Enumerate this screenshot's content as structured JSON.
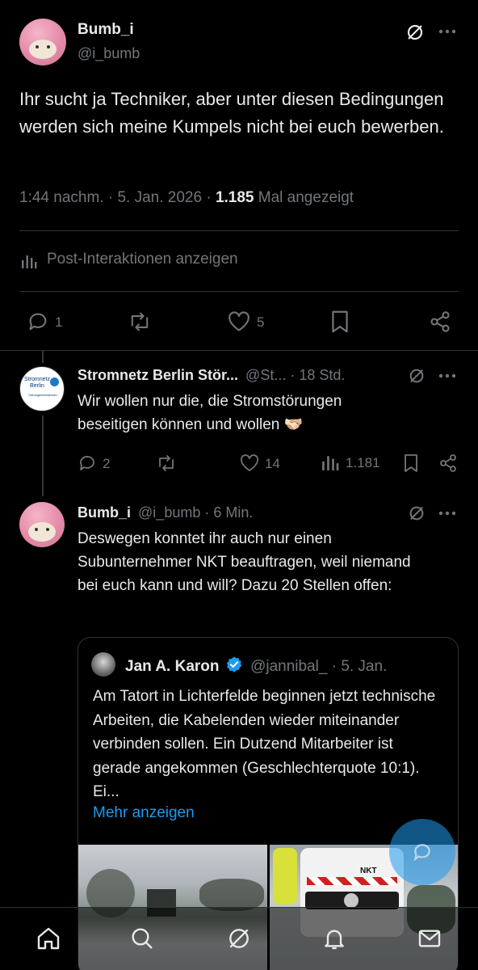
{
  "main_post": {
    "author_name": "Bumb_i",
    "author_handle": "@i_bumb",
    "text": "Ihr sucht ja Techniker, aber unter diesen Bedingungen werden sich meine Kumpels nicht bei euch bewerben.",
    "time": "1:44 nachm.",
    "date": "5. Jan. 2026",
    "views_count": "1.185",
    "views_label": "Mal angezeigt",
    "interactions_label": "Post-Interaktionen anzeigen",
    "replies": "1",
    "reposts": "",
    "likes": "5"
  },
  "reply1": {
    "author_name": "Stromnetz Berlin Stör...",
    "author_handle": "@St...",
    "time": "18 Std.",
    "text": "Wir wollen nur die, die Stromstörungen beseitigen können und wollen 🫱🏻‍🫲🏼",
    "avatar_text": "Stromnetz Berlin",
    "avatar_subtext": "Störungsinformationen",
    "replies": "2",
    "likes": "14",
    "views": "1.181"
  },
  "reply2": {
    "author_name": "Bumb_i",
    "author_handle": "@i_bumb",
    "time": "6 Min.",
    "text": "Deswegen konntet ihr auch nur einen Subunternehmer NKT beauftragen, weil niemand bei euch kann und will? Dazu 20 Stellen offen:"
  },
  "quote": {
    "author_name": "Jan A. Karon",
    "author_handle": "@jannibal_",
    "time": "5. Jan.",
    "text": "Am Tatort in Lichterfelde beginnen jetzt technische Arbeiten, die Kabelenden wieder miteinander verbinden sollen. Ein Dutzend Mitarbeiter ist gerade angekommen (Geschlechterquote 10:1). Ei...",
    "more_label": "Mehr anzeigen",
    "van_logo": "NKT"
  },
  "icons": {
    "grok": "grok-icon",
    "more": "more-icon",
    "reply": "reply-icon",
    "repost": "repost-icon",
    "like": "like-icon",
    "bookmark": "bookmark-icon",
    "share": "share-icon",
    "analytics": "analytics-icon",
    "verified": "verified-icon"
  },
  "nav": [
    "home-icon",
    "search-icon",
    "grok-icon",
    "notifications-icon",
    "messages-icon"
  ],
  "colors": {
    "background": "#000000",
    "text": "#e7e9ea",
    "muted": "#71767b",
    "link": "#1d9bf0",
    "verified": "#1d9bf0",
    "divider": "#2f3336"
  }
}
